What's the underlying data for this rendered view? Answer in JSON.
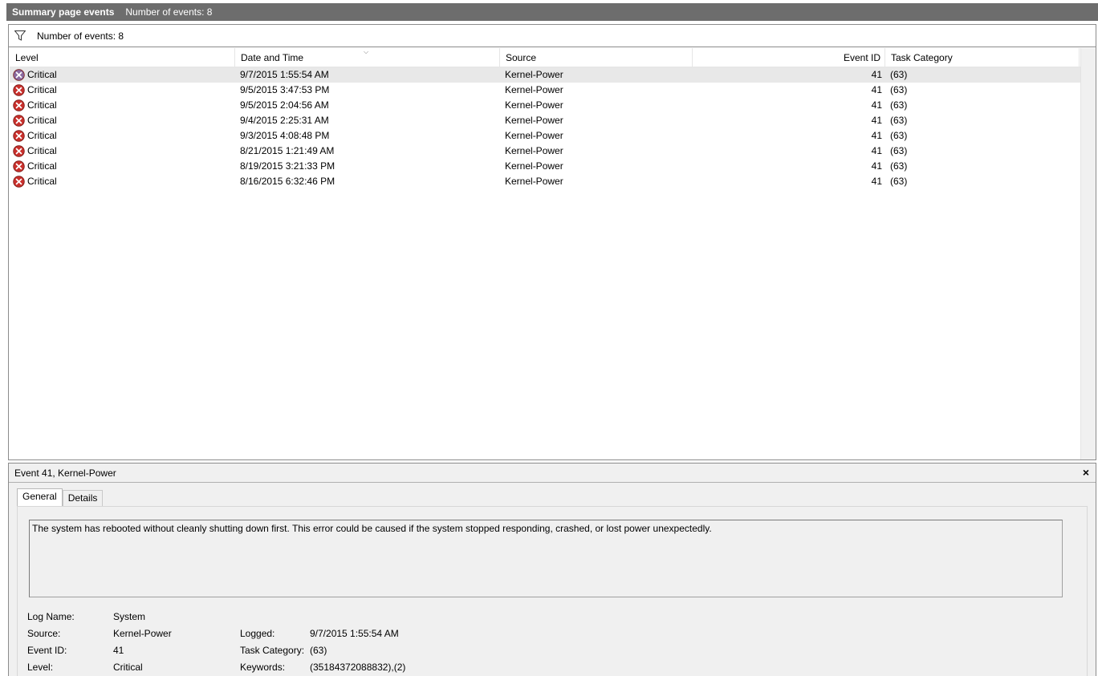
{
  "header": {
    "title": "Summary page events",
    "count": "Number of events: 8"
  },
  "filter": {
    "icon": "filter-icon",
    "count": "Number of events: 8"
  },
  "columns": {
    "level": "Level",
    "date": "Date and Time",
    "source": "Source",
    "event_id": "Event ID",
    "task_category": "Task Category"
  },
  "events": [
    {
      "level": "Critical",
      "date": "9/7/2015 1:55:54 AM",
      "source": "Kernel-Power",
      "event_id": "41",
      "category": "(63)"
    },
    {
      "level": "Critical",
      "date": "9/5/2015 3:47:53 PM",
      "source": "Kernel-Power",
      "event_id": "41",
      "category": "(63)"
    },
    {
      "level": "Critical",
      "date": "9/5/2015 2:04:56 AM",
      "source": "Kernel-Power",
      "event_id": "41",
      "category": "(63)"
    },
    {
      "level": "Critical",
      "date": "9/4/2015 2:25:31 AM",
      "source": "Kernel-Power",
      "event_id": "41",
      "category": "(63)"
    },
    {
      "level": "Critical",
      "date": "9/3/2015 4:08:48 PM",
      "source": "Kernel-Power",
      "event_id": "41",
      "category": "(63)"
    },
    {
      "level": "Critical",
      "date": "8/21/2015 1:21:49 AM",
      "source": "Kernel-Power",
      "event_id": "41",
      "category": "(63)"
    },
    {
      "level": "Critical",
      "date": "8/19/2015 3:21:33 PM",
      "source": "Kernel-Power",
      "event_id": "41",
      "category": "(63)"
    },
    {
      "level": "Critical",
      "date": "8/16/2015 6:32:46 PM",
      "source": "Kernel-Power",
      "event_id": "41",
      "category": "(63)"
    }
  ],
  "detail": {
    "title": "Event 41, Kernel-Power",
    "close": "×",
    "tabs": [
      "General",
      "Details"
    ],
    "description": "The system has rebooted without cleanly shutting down first. This error could be caused if the system stopped responding, crashed, or lost power unexpectedly.",
    "props": {
      "log_name_label": "Log Name:",
      "log_name": "System",
      "source_label": "Source:",
      "source": "Kernel-Power",
      "logged_label": "Logged:",
      "logged": "9/7/2015 1:55:54 AM",
      "event_id_label": "Event ID:",
      "event_id": "41",
      "task_category_label": "Task Category:",
      "task_category": "(63)",
      "level_label": "Level:",
      "level": "Critical",
      "keywords_label": "Keywords:",
      "keywords": "(35184372088832),(2)"
    }
  },
  "colors": {
    "title_bar": "#6d6d6d",
    "critical_red": "#c9302c",
    "critical_selected": "#8a6aa0",
    "selected_row": "#e8e8e8"
  }
}
